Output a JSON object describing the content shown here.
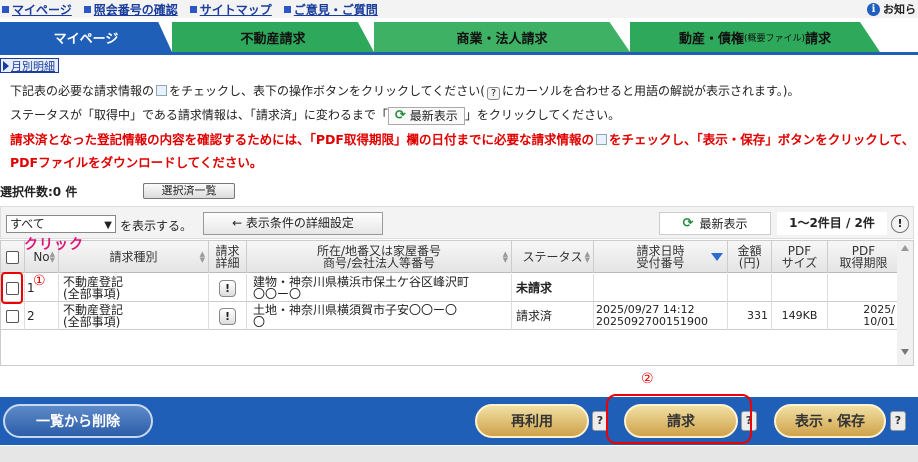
{
  "toplinks": [
    {
      "label": "マイページ"
    },
    {
      "label": "照会番号の確認"
    },
    {
      "label": "サイトマップ"
    },
    {
      "label": "ご意見・ご質問"
    }
  ],
  "notice_label": "お知ら",
  "tabs": {
    "mypage": "マイページ",
    "realestate": "不動産請求",
    "corp": "商業・法人請求",
    "movable_main": "動産・債権",
    "movable_small": "(概要ファイル)",
    "movable_suffix": "請求"
  },
  "monthly_label": "月別明細",
  "instructions": {
    "line1_a": "下記表の必要な請求情報の",
    "line1_b": "をチェックし、表下の操作ボタンをクリックしてください(",
    "line1_c": "にカーソルを合わせると用語の解説が表示されます。)。",
    "line2_a": "ステータスが「取得中」である請求情報は、「請求済」に変わるまで「",
    "line2_btn": "最新表示",
    "line2_b": "」をクリックしてください。",
    "red_a": "請求済となった登記情報の内容を確認するためには、",
    "red_b": "「PDF取得期限」欄の日付までに必要な請求情報の",
    "red_c": "をチェックし、「表示・保存」ボタンをクリックして、PDFファイルをダウンロードしてください。"
  },
  "selection": {
    "label": "選択件数:0 件",
    "button": "選択済一覧"
  },
  "filter": {
    "select_value": "すべて",
    "label": "を表示する。",
    "detail_button": "← 表示条件の詳細設定",
    "refresh_button": "最新表示",
    "pager": "1〜2件目 / 2件"
  },
  "table": {
    "headers": {
      "no": "No",
      "type": "請求種別",
      "detail": "請求\n詳細",
      "location": "所在/地番又は家屋番号\n商号/会社法人等番号",
      "status": "ステータス",
      "date": "請求日時\n受付番号",
      "amount": "金額\n(円)",
      "pdf_size": "PDF\nサイズ",
      "pdf_deadline": "PDF\n取得期限"
    },
    "rows": [
      {
        "no": "1",
        "type": "不動産登記\n(全部事項)",
        "location": "建物・神奈川県横浜市保土ケ谷区峰沢町\n〇〇ー〇",
        "status": "未請求",
        "date": "",
        "amount": "",
        "size": "",
        "deadline": ""
      },
      {
        "no": "2",
        "type": "不動産登記\n(全部事項)",
        "location": "土地・神奈川県横須賀市子安〇〇ー〇\n〇",
        "status": "請求済",
        "date": "2025/09/27 14:12\n2025092700151900",
        "amount": "331",
        "size": "149KB",
        "deadline": "2025/\n10/01"
      }
    ]
  },
  "annotations": {
    "click": "クリック",
    "num1": "①",
    "num2": "②"
  },
  "buttons": {
    "delete": "一覧から削除",
    "reuse": "再利用",
    "request": "請求",
    "save": "表示・保存",
    "help": "?"
  },
  "colors": {
    "primary_blue": "#1f5fb8",
    "tab_green": "#2ea85a",
    "alert_red": "#e00000",
    "gold": "#cfa24a"
  }
}
